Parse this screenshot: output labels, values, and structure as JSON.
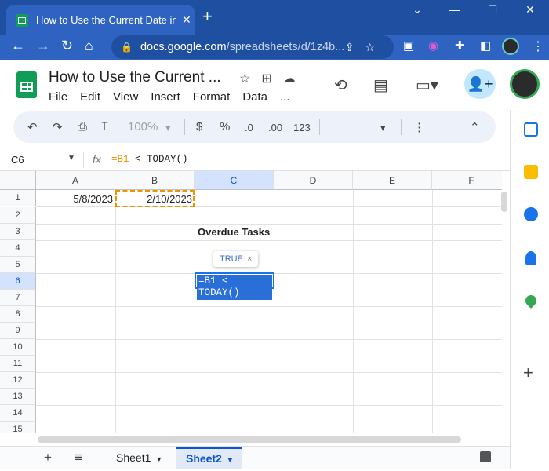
{
  "browser": {
    "tab_title": "How to Use the Current Date in G",
    "tab_close": "✕",
    "new_tab": "+",
    "window_controls": {
      "chevron": "⌄",
      "minimize": "—",
      "maximize": "☐",
      "close": "✕"
    },
    "nav": {
      "back": "←",
      "forward": "→",
      "reload": "↻",
      "home": "⌂"
    },
    "url_host": "docs.google.com",
    "url_path": "/spreadsheets/d/1z4b..."
  },
  "doc": {
    "title": "How to Use the Current ...",
    "menu": [
      "File",
      "Edit",
      "View",
      "Insert",
      "Format",
      "Data",
      "..."
    ]
  },
  "toolbar": {
    "undo": "↶",
    "redo": "↷",
    "print": "⎙",
    "paint": "⌶",
    "zoom": "100%",
    "currency": "$",
    "percent": "%",
    "dec_less": ".0",
    "dec_more": ".00",
    "number_format": "123",
    "more": "⋮",
    "collapse": "⌃",
    "dropdown": "▾"
  },
  "formula_bar": {
    "name_box": "C6",
    "fx": "fx",
    "formula_ref": "=B1",
    "formula_rest": " < TODAY()"
  },
  "grid": {
    "columns": [
      "A",
      "B",
      "C",
      "D",
      "E",
      "F"
    ],
    "rows": [
      "1",
      "2",
      "3",
      "4",
      "5",
      "6",
      "7",
      "8",
      "9",
      "10",
      "11",
      "12",
      "13",
      "14",
      "15"
    ],
    "cells": {
      "A1": "5/8/2023",
      "B1": "2/10/2023",
      "C3": "Overdue Tasks"
    },
    "editor_text": "=B1 < TODAY()",
    "tooltip_value": "TRUE",
    "tooltip_close": "×"
  },
  "sheets": {
    "add": "+",
    "list_icon": "≡",
    "tabs": [
      {
        "name": "Sheet1",
        "active": false
      },
      {
        "name": "Sheet2",
        "active": true
      }
    ],
    "tab_arrow": "▾"
  },
  "side_panel": {
    "add": "+"
  },
  "colors": {
    "browser_frame": "#1f4fa0",
    "accent": "#1a73e8",
    "copy_range": "#f09300",
    "sheets_green": "#0f9d58"
  }
}
